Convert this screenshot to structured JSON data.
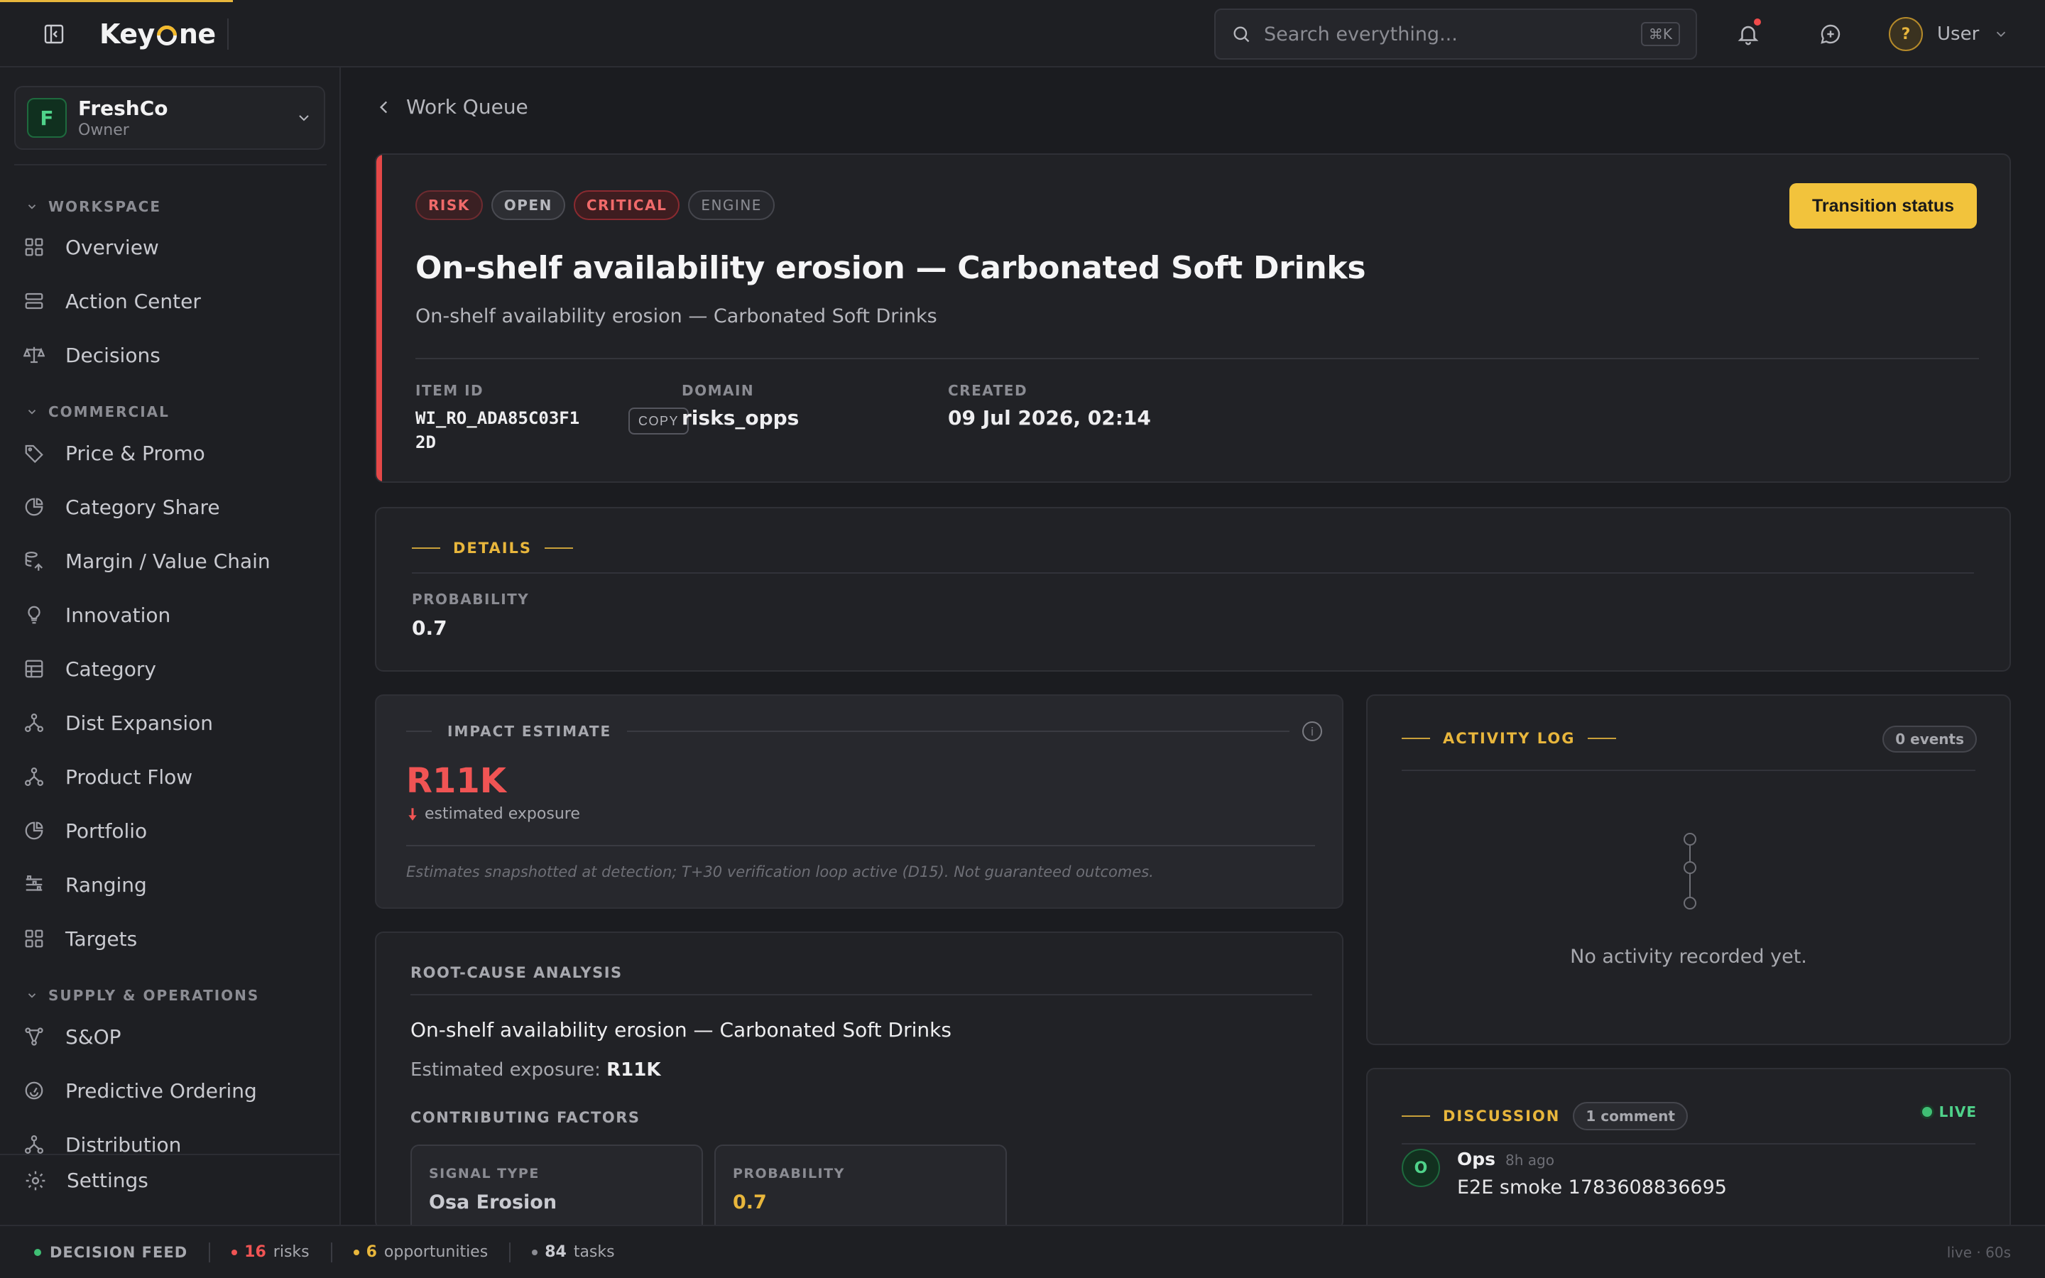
{
  "topbar": {
    "logo": {
      "before": "Key",
      "after": "ne"
    },
    "search": {
      "placeholder": "Search everything...",
      "shortcut": "⌘K"
    },
    "user": {
      "avatar": "?",
      "label": "User"
    },
    "icons": [
      "sidebar-toggle-icon",
      "search-icon",
      "bell-icon",
      "chat-icon",
      "chevron-down-icon"
    ]
  },
  "sidebar": {
    "org": {
      "initial": "F",
      "name": "FreshCo",
      "role": "Owner"
    },
    "sections": {
      "workspace": "WORKSPACE",
      "commercial": "COMMERCIAL",
      "supply": "SUPPLY & OPERATIONS"
    },
    "items": [
      {
        "label": "Overview",
        "icon": "grid-icon"
      },
      {
        "label": "Action Center",
        "icon": "stack-icon"
      },
      {
        "label": "Decisions",
        "icon": "scale-icon"
      },
      {
        "label": "Price & Promo",
        "icon": "tag-icon"
      },
      {
        "label": "Category Share",
        "icon": "pie-icon"
      },
      {
        "label": "Margin / Value Chain",
        "icon": "chain-icon"
      },
      {
        "label": "Innovation",
        "icon": "lightbulb-icon"
      },
      {
        "label": "Category",
        "icon": "layers-icon"
      },
      {
        "label": "Dist Expansion",
        "icon": "network-icon"
      },
      {
        "label": "Product Flow",
        "icon": "network-icon"
      },
      {
        "label": "Portfolio",
        "icon": "pie-icon"
      },
      {
        "label": "Ranging",
        "icon": "shelves-icon"
      },
      {
        "label": "Targets",
        "icon": "grid-icon"
      },
      {
        "label": "S&OP",
        "icon": "funnel-icon"
      },
      {
        "label": "Predictive Ordering",
        "icon": "gauge-icon"
      },
      {
        "label": "Distribution",
        "icon": "network-icon"
      }
    ],
    "settings": "Settings"
  },
  "main": {
    "back_label": "Work Queue",
    "hero": {
      "chips": [
        "RISK",
        "OPEN",
        "CRITICAL",
        "ENGINE"
      ],
      "transition_button": "Transition status",
      "title": "On-shelf availability erosion — Carbonated Soft Drinks",
      "subtitle": "On-shelf availability erosion — Carbonated Soft Drinks",
      "meta": {
        "item_id_label": "ITEM ID",
        "item_id_value": "WI_RO_ADA85C03F12D",
        "copy_label": "COPY",
        "domain_label": "DOMAIN",
        "domain_value": "risks_opps",
        "created_label": "CREATED",
        "created_value": "09 Jul 2026, 02:14"
      }
    },
    "details": {
      "title": "DETAILS",
      "probability_label": "PROBABILITY",
      "probability_value": "0.7"
    },
    "impact": {
      "title": "IMPACT ESTIMATE",
      "info": "i",
      "value": "R11K",
      "caption": "estimated exposure",
      "note": "Estimates snapshotted at detection; T+30 verification loop active (D15). Not guaranteed outcomes.",
      "value_color": "#f05454"
    },
    "rca": {
      "title": "ROOT-CAUSE ANALYSIS",
      "line1": "On-shelf availability erosion — Carbonated Soft Drinks",
      "exposure_label": "Estimated exposure: ",
      "exposure_value": "R11K",
      "factors_title": "CONTRIBUTING FACTORS",
      "factors": [
        {
          "label": "SIGNAL TYPE",
          "value": "Osa Erosion"
        },
        {
          "label": "PROBABILITY",
          "value": "0.7"
        }
      ]
    },
    "activity": {
      "title": "ACTIVITY LOG",
      "count": "0 events",
      "empty": "No activity recorded yet."
    },
    "discussion": {
      "title": "DISCUSSION",
      "count": "1 comment",
      "live": "LIVE",
      "comments": [
        {
          "initial": "O",
          "author": "Ops",
          "time": "8h ago",
          "text": "E2E smoke 1783608836695"
        }
      ]
    }
  },
  "statusbar": {
    "feed": "DECISION FEED",
    "risks_count": "16",
    "risks_label": "risks",
    "opps_count": "6",
    "opps_label": "opportunities",
    "tasks_count": "84",
    "tasks_label": "tasks",
    "right": "live · 60s"
  },
  "colors": {
    "accent": "#f2c33c",
    "risk": "#f05454",
    "live": "#3fbf74",
    "background": "#1b1c20"
  }
}
